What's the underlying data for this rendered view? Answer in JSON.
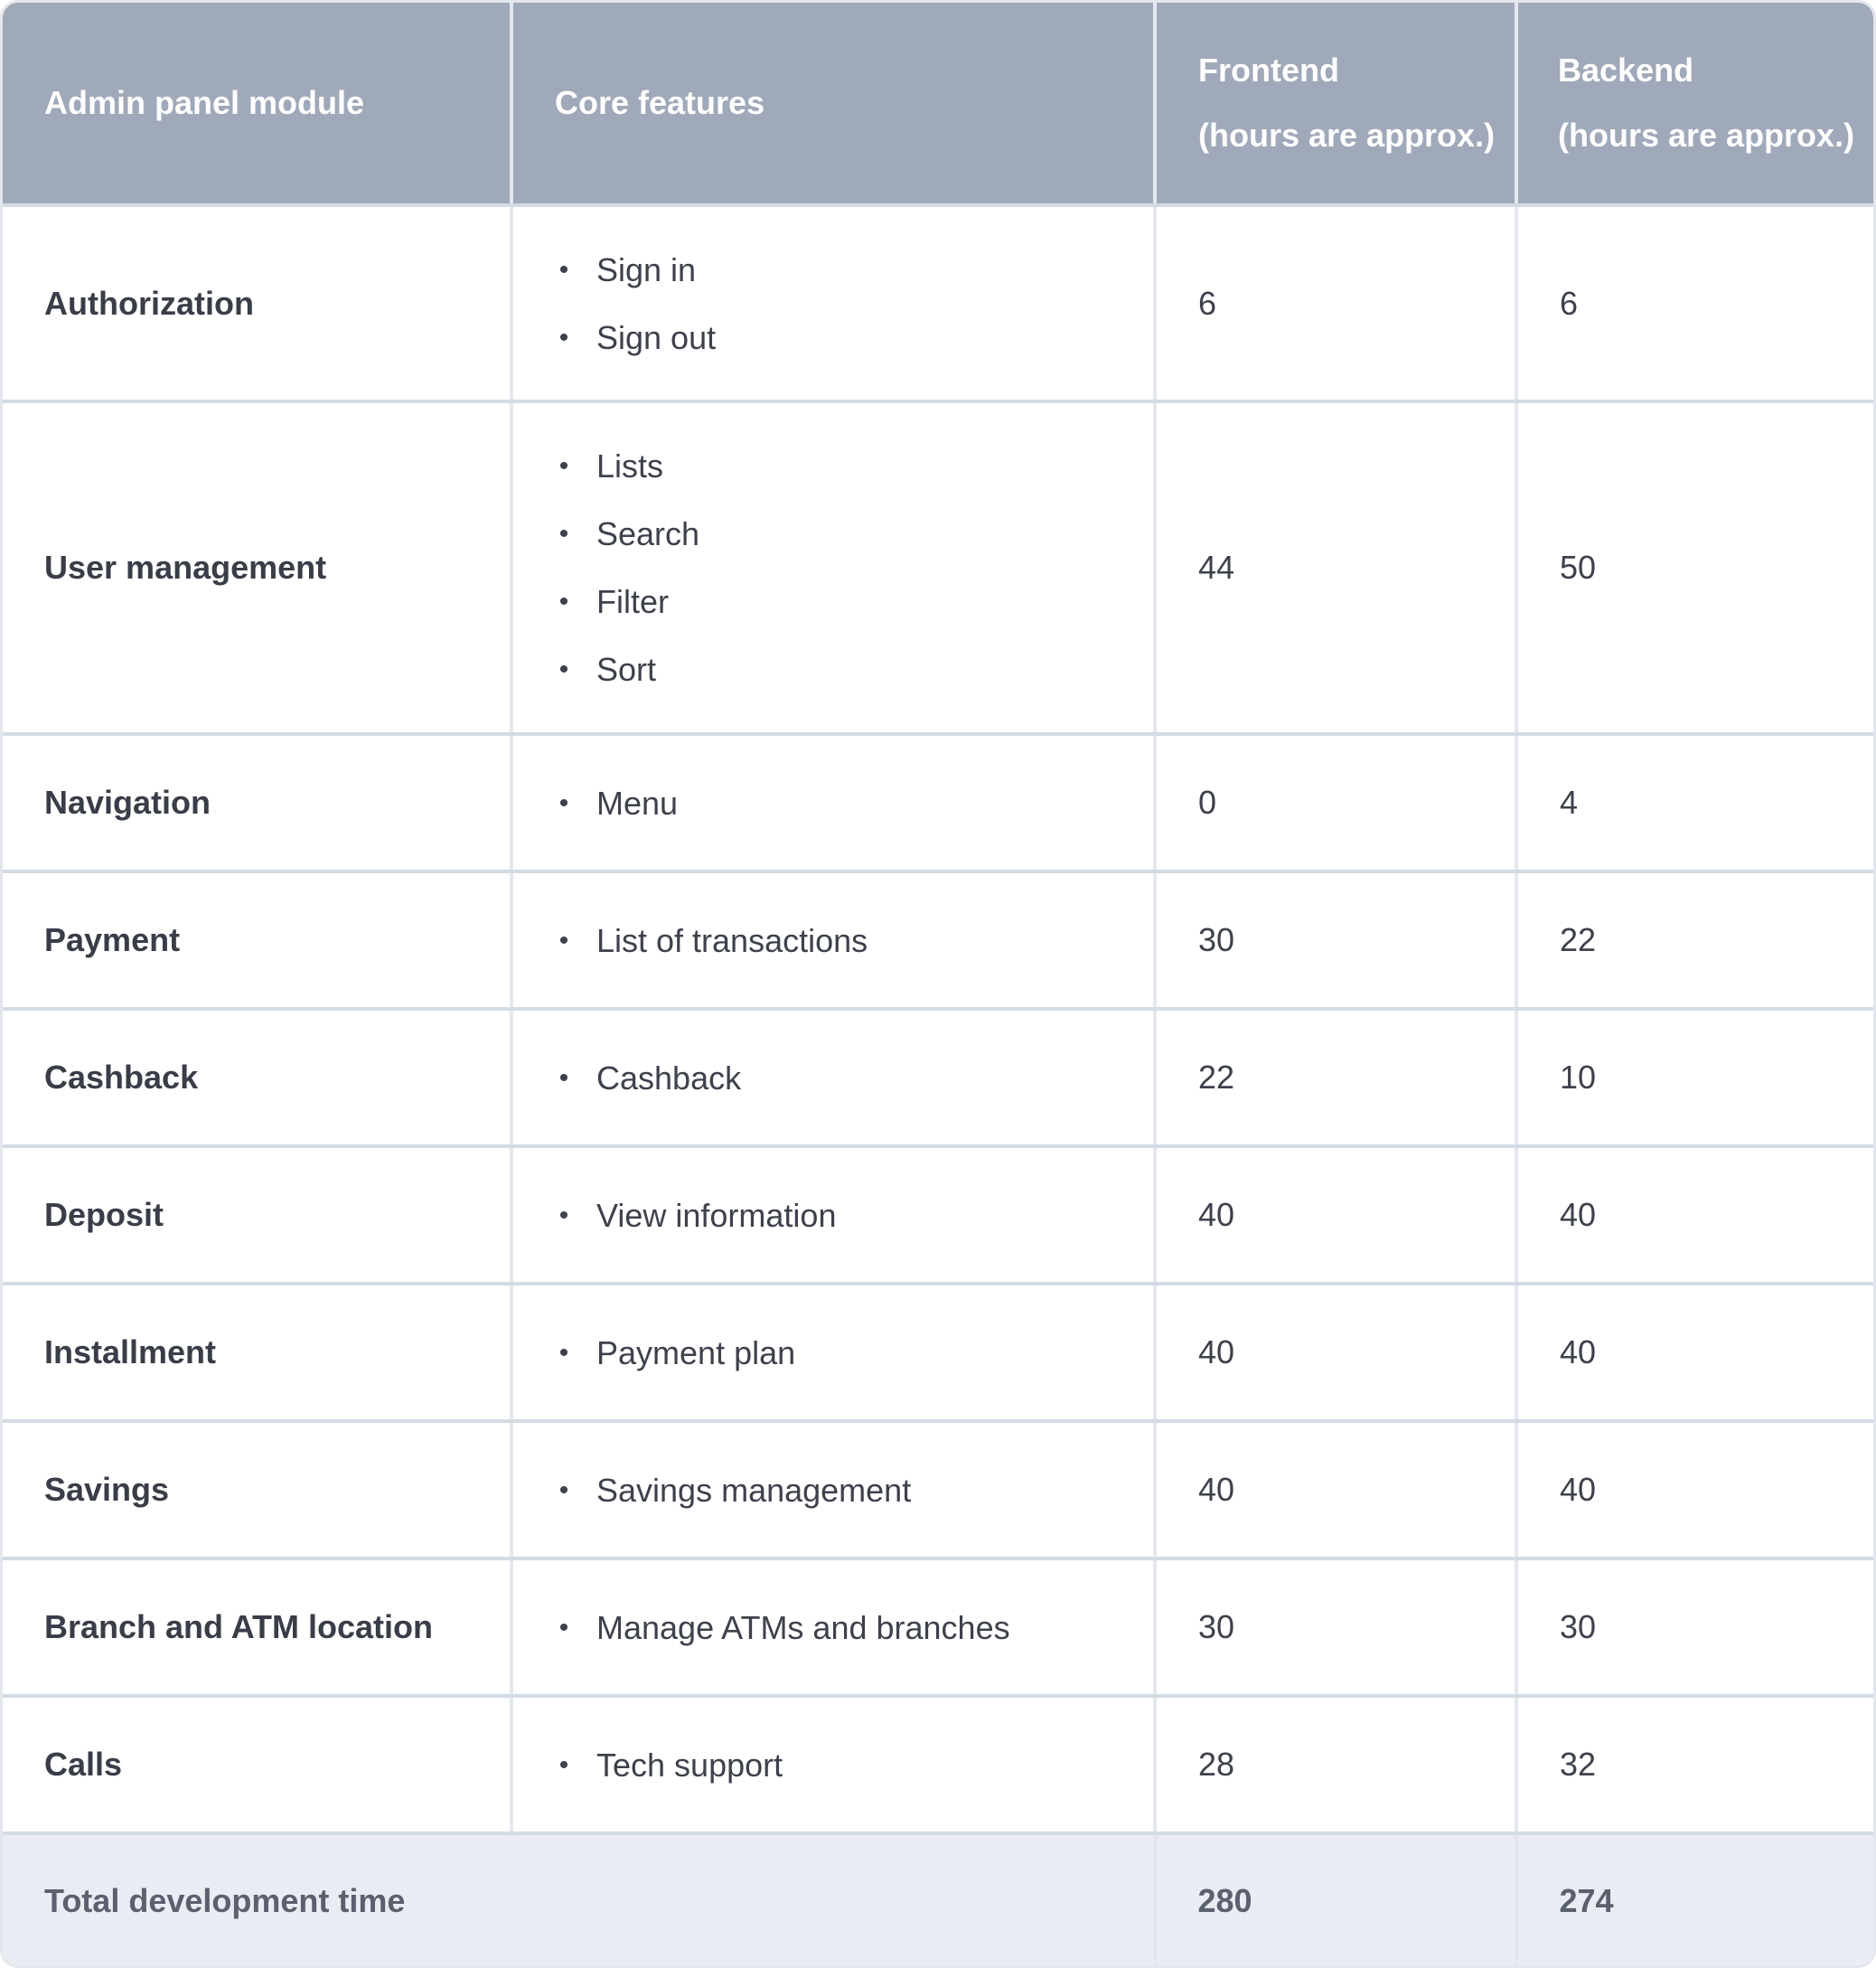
{
  "table": {
    "headers": {
      "module": "Admin panel module",
      "features": "Core features",
      "frontend": {
        "line1": "Frontend",
        "line2": "(hours are approx.)"
      },
      "backend": {
        "line1": "Backend",
        "line2": "(hours are approx.)"
      }
    },
    "rows": [
      {
        "module": "Authorization",
        "features": [
          "Sign in",
          "Sign out"
        ],
        "frontend": "6",
        "backend": "6"
      },
      {
        "module": "User management",
        "features": [
          "Lists",
          "Search",
          "Filter",
          "Sort"
        ],
        "frontend": "44",
        "backend": "50"
      },
      {
        "module": "Navigation",
        "features": [
          "Menu"
        ],
        "frontend": "0",
        "backend": "4"
      },
      {
        "module": "Payment",
        "features": [
          "List of transactions"
        ],
        "frontend": "30",
        "backend": "22"
      },
      {
        "module": "Cashback",
        "features": [
          "Cashback"
        ],
        "frontend": "22",
        "backend": "10"
      },
      {
        "module": "Deposit",
        "features": [
          "View information"
        ],
        "frontend": "40",
        "backend": "40"
      },
      {
        "module": "Installment",
        "features": [
          "Payment plan"
        ],
        "frontend": "40",
        "backend": "40"
      },
      {
        "module": "Savings",
        "features": [
          "Savings management"
        ],
        "frontend": "40",
        "backend": "40"
      },
      {
        "module": "Branch and ATM location",
        "features": [
          "Manage ATMs and branches"
        ],
        "frontend": "30",
        "backend": "30"
      },
      {
        "module": "Calls",
        "features": [
          "Tech support"
        ],
        "frontend": "28",
        "backend": "32"
      }
    ],
    "footer": {
      "label": "Total development time",
      "frontend_total": "280",
      "backend_total": "274"
    },
    "bullet_glyph": "•"
  },
  "colors": {
    "header_bg": "#a0a9b9",
    "footer_bg": "#e9ecf3",
    "text": "#3d414c",
    "row_border": "#d3dbe4"
  }
}
